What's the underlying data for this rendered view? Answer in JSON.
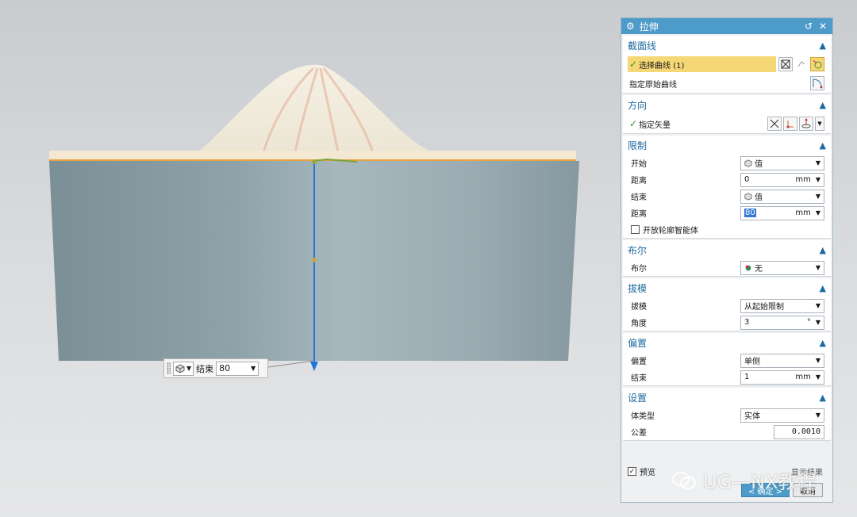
{
  "dialog": {
    "title": "拉伸",
    "sections": {
      "section_curve": {
        "title": "截面线",
        "select_curve_label": "选择曲线 (1)",
        "specify_origin_curve_label": "指定原始曲线"
      },
      "direction": {
        "title": "方向",
        "specify_vector_label": "指定矢量"
      },
      "limits": {
        "title": "限制",
        "start_label": "开始",
        "start_value": "值",
        "distance1_label": "距离",
        "distance1_value": "0",
        "distance1_unit": "mm",
        "end_label": "结束",
        "end_value": "值",
        "distance2_label": "距离",
        "distance2_value": "80",
        "distance2_unit": "mm",
        "open_profile_label": "开放轮廓智能体"
      },
      "boolean": {
        "title": "布尔",
        "boolean_label": "布尔",
        "boolean_value": "无"
      },
      "draft": {
        "title": "拔模",
        "draft_label": "拔模",
        "draft_value": "从起始限制",
        "angle_label": "角度",
        "angle_value": "3",
        "angle_unit": "°"
      },
      "offset": {
        "title": "偏置",
        "offset_label": "偏置",
        "offset_value": "单侧",
        "end_label": "结束",
        "end_value": "1",
        "end_unit": "mm"
      },
      "settings": {
        "title": "设置",
        "body_type_label": "体类型",
        "body_type_value": "实体",
        "tolerance_label": "公差",
        "tolerance_value": "0.0010"
      }
    },
    "footer": {
      "preview_label": "预览",
      "preview_checked": true,
      "show_result_label": "显示结果",
      "ok_label": "< 确定 >",
      "cancel_label": "取消"
    }
  },
  "viewport": {
    "inline_label": "结束",
    "inline_value": "80"
  },
  "watermark": "UG—NX教程",
  "colors": {
    "title_blue": "#4d9bc9",
    "highlight_yellow": "#f6d776",
    "vector_blue": "#1f78d6",
    "model_gray": "#8fa3ac",
    "dome_cream": "#f3efdf"
  }
}
